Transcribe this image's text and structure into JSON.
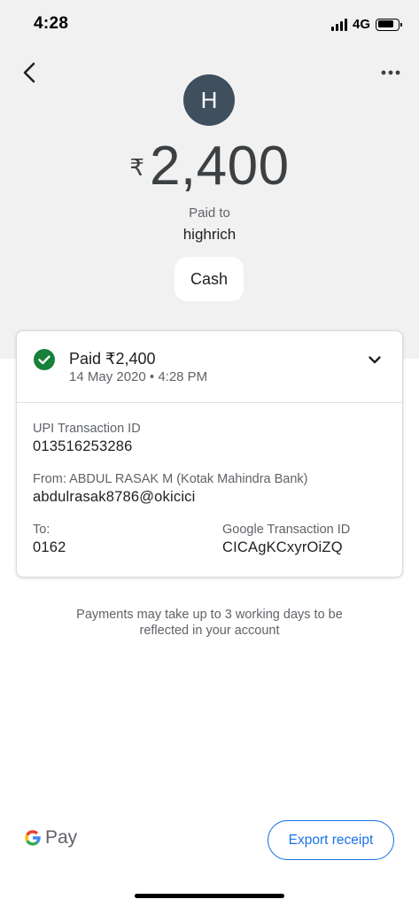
{
  "status_bar": {
    "time": "4:28",
    "network": "4G",
    "battery_level": 0.85
  },
  "header": {
    "back_icon": "chevron-left-icon",
    "more_icon": "more-horizontal-icon"
  },
  "payment": {
    "avatar_letter": "H",
    "currency_symbol": "₹",
    "amount": "2,400",
    "paid_to_label": "Paid to",
    "payee_name": "highrich",
    "note": "Cash"
  },
  "details": {
    "status": "Paid ₹2,400",
    "date": "14 May 2020 • 4:28 PM",
    "status_icon": "check-circle-icon",
    "expand_icon": "chevron-down-icon",
    "upi_label": "UPI Transaction ID",
    "upi_value": "013516253286",
    "from_label": "From: ABDUL RASAK M (Kotak Mahindra Bank)",
    "from_value": "abdulrasak8786@okicici",
    "to_label": "To:",
    "to_value": "0162",
    "google_txn_label": "Google Transaction ID",
    "google_txn_value": "CICAgKCxyrOiZQ"
  },
  "disclaimer": "Payments may take up to 3 working days to be reflected in your account",
  "footer": {
    "brand": "Pay",
    "export_label": "Export receipt"
  },
  "colors": {
    "accent": "#1a73e8",
    "success": "#188038",
    "avatar": "#3f4f5e"
  }
}
